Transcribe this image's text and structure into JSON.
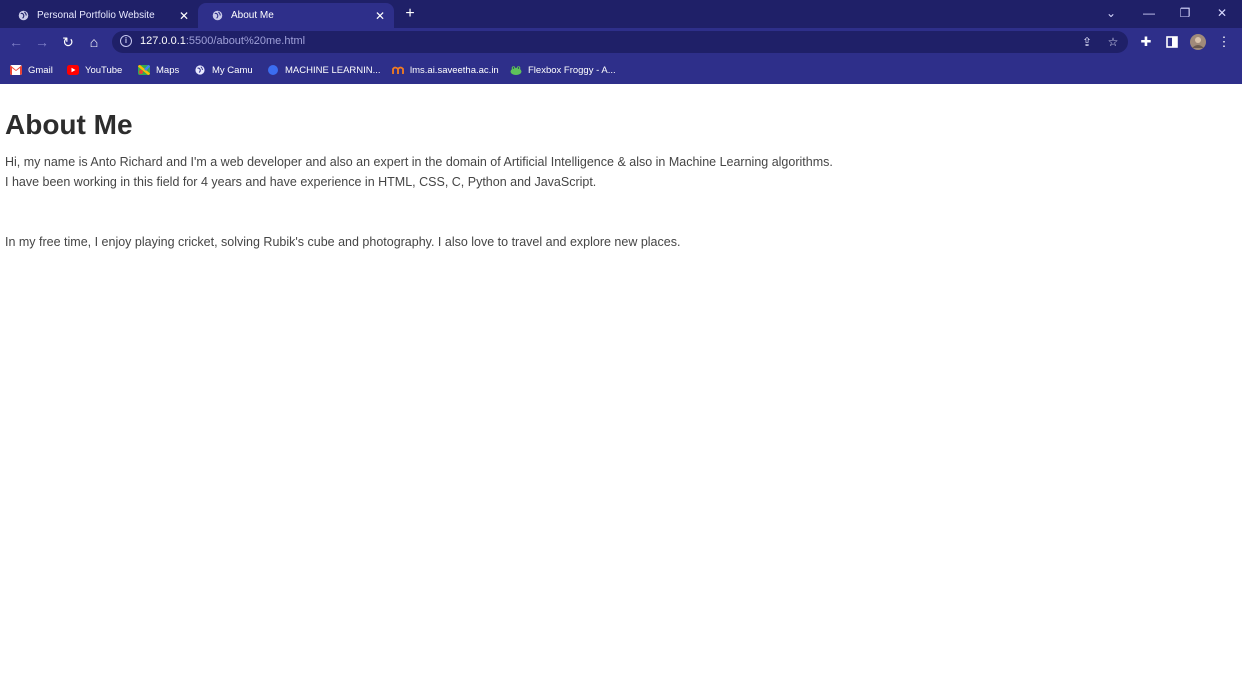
{
  "browser": {
    "tabs": [
      {
        "title": "Personal Portfolio Website",
        "close": "✕"
      },
      {
        "title": "About Me",
        "close": "✕"
      }
    ],
    "new_tab": "+",
    "window_controls": {
      "dropdown": "⌄",
      "minimize": "—",
      "restore": "❐",
      "close": "✕"
    },
    "url_host": "127.0.0.1",
    "url_rest": ":5500/about%20me.html",
    "bookmarks": [
      {
        "label": "Gmail",
        "icon": "gmail-icon",
        "color": "#ea4335"
      },
      {
        "label": "YouTube",
        "icon": "youtube-icon",
        "color": "#ff0000"
      },
      {
        "label": "Maps",
        "icon": "maps-icon",
        "color": "#34a853"
      },
      {
        "label": "My Camu",
        "icon": "globe-icon",
        "color": "#e8e9ff"
      },
      {
        "label": "MACHINE LEARNIN...",
        "icon": "circle-icon",
        "color": "#3b6df0"
      },
      {
        "label": "lms.ai.saveetha.ac.in",
        "icon": "lms-icon",
        "color": "#f47c20"
      },
      {
        "label": "Flexbox Froggy - A...",
        "icon": "frog-icon",
        "color": "#5ec25a"
      }
    ]
  },
  "page": {
    "heading": "About Me",
    "paragraph1_line1": "Hi, my name is Anto Richard and I'm a web developer and also an expert in the domain of Artificial Intelligence & also in Machine Learning algorithms.",
    "paragraph1_line2": "I have been working in this field for 4 years and have experience in HTML, CSS, C, Python and JavaScript.",
    "paragraph2": "In my free time, I enjoy playing cricket, solving Rubik's cube and photography. I also love to travel and explore new places."
  },
  "colors": {
    "chrome": "#2e2f8a",
    "tabstrip": "#1f2068",
    "heading": "#2d2d2d",
    "text": "#454545"
  }
}
